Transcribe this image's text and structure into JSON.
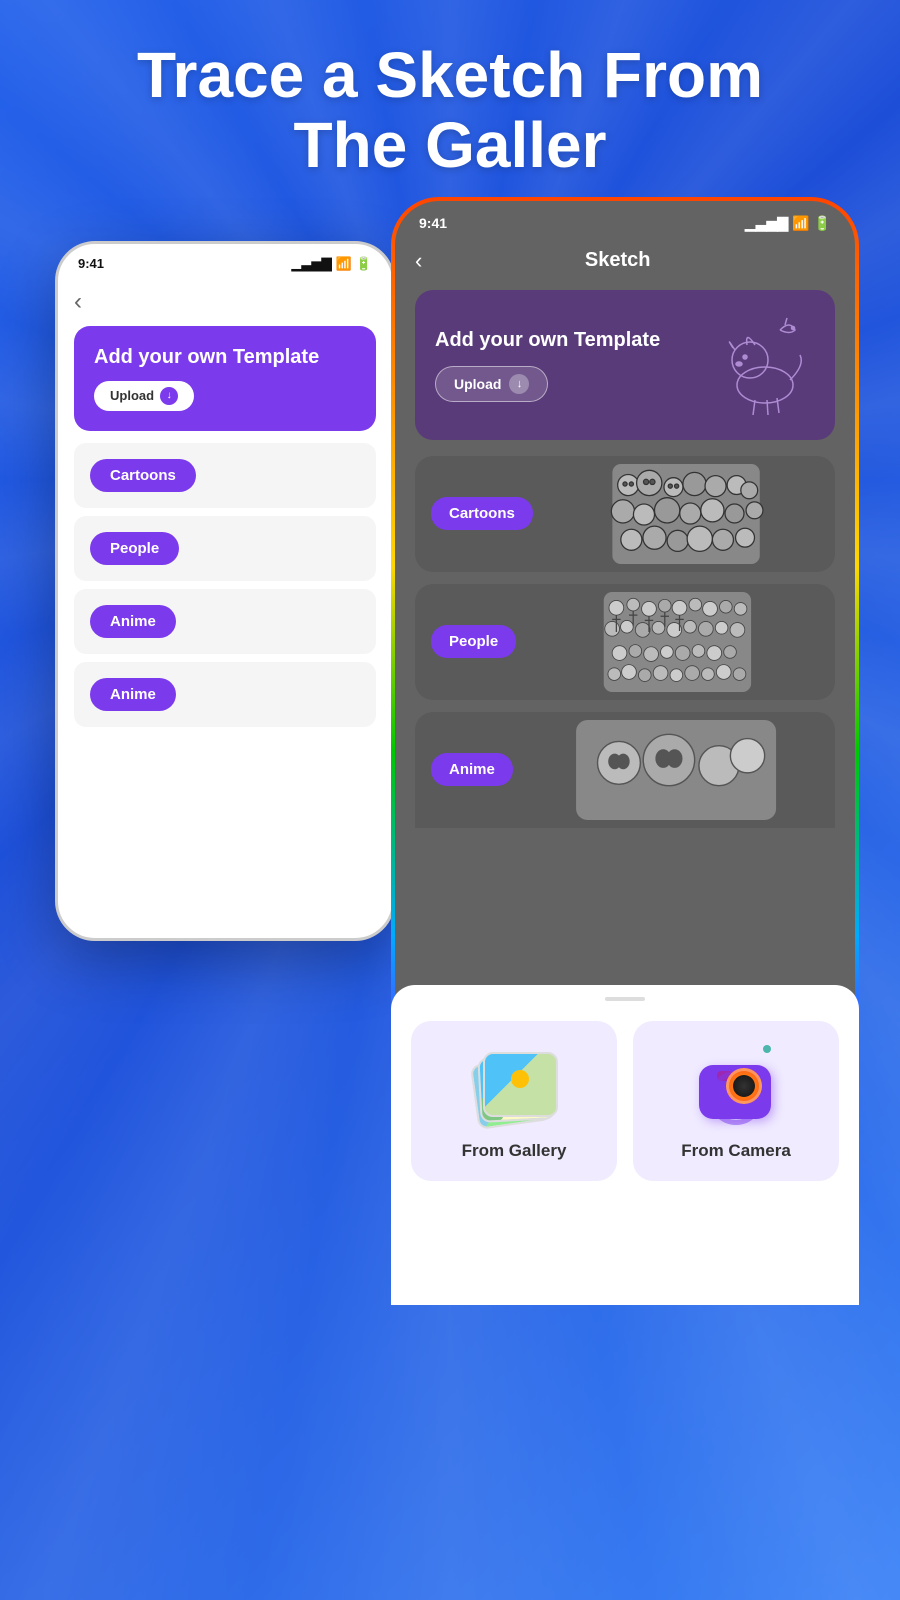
{
  "headline": {
    "line1": "Trace a Sketch From",
    "line2": "The Galler"
  },
  "back_phone": {
    "status_time": "9:41",
    "add_card": {
      "title": "Add your own Template",
      "upload_label": "Upload"
    },
    "categories": [
      {
        "label": "Cartoons"
      },
      {
        "label": "People"
      },
      {
        "label": "Anime"
      },
      {
        "label": "Anime"
      }
    ]
  },
  "front_phone": {
    "status_time": "9:41",
    "header_title": "Sketch",
    "add_card": {
      "title": "Add your own Template",
      "upload_label": "Upload"
    },
    "sections": [
      {
        "label": "Cartoons"
      },
      {
        "label": "People"
      }
    ],
    "bottom_sheet": {
      "option1_label": "From Gallery",
      "option2_label": "From Camera"
    }
  },
  "icons": {
    "back_arrow": "‹",
    "battery": "▮▮▮",
    "signal": "▁▃▅▇",
    "wifi": "wifi",
    "download": "↓"
  }
}
